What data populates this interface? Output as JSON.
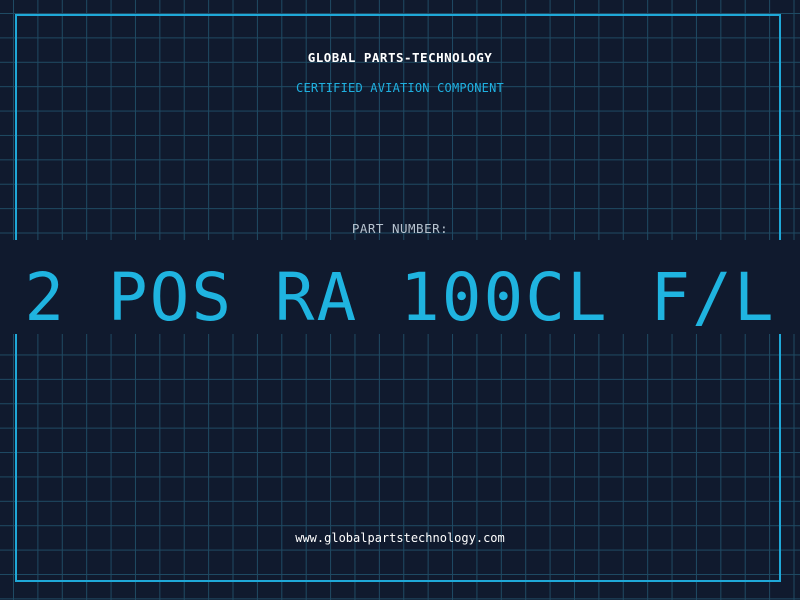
{
  "header": {
    "company": "GLOBAL PARTS-TECHNOLOGY",
    "tagline": "CERTIFIED AVIATION COMPONENT"
  },
  "part": {
    "label": "PART NUMBER:",
    "number": "2 POS RA 100CL F/L"
  },
  "footer": {
    "website": "www.globalpartstechnology.com"
  },
  "colors": {
    "background": "#101a2e",
    "grid": "#1f4a63",
    "accent": "#1fb4e0",
    "text": "#ffffff",
    "muted": "#b7c3cf"
  }
}
